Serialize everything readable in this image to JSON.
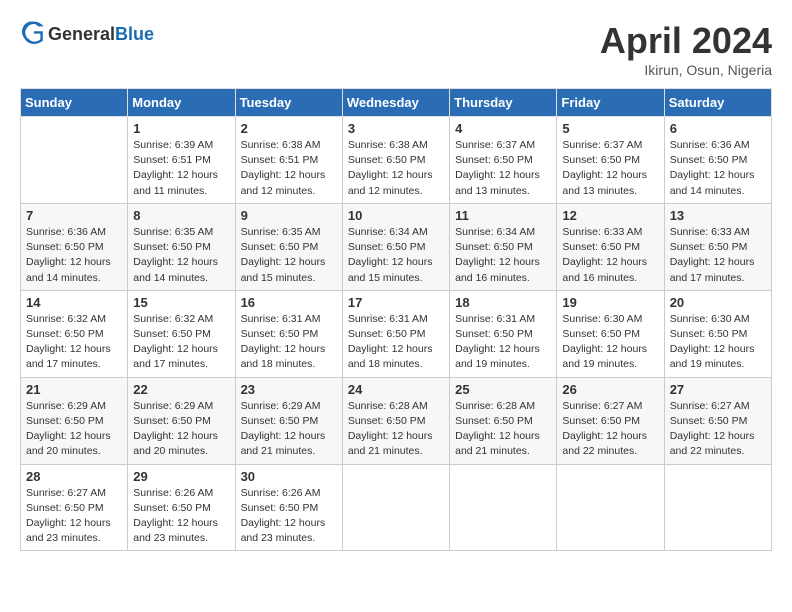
{
  "header": {
    "logo_line1": "General",
    "logo_line2": "Blue",
    "month": "April 2024",
    "location": "Ikirun, Osun, Nigeria"
  },
  "days_of_week": [
    "Sunday",
    "Monday",
    "Tuesday",
    "Wednesday",
    "Thursday",
    "Friday",
    "Saturday"
  ],
  "weeks": [
    [
      {
        "num": "",
        "info": ""
      },
      {
        "num": "1",
        "info": "Sunrise: 6:39 AM\nSunset: 6:51 PM\nDaylight: 12 hours\nand 11 minutes."
      },
      {
        "num": "2",
        "info": "Sunrise: 6:38 AM\nSunset: 6:51 PM\nDaylight: 12 hours\nand 12 minutes."
      },
      {
        "num": "3",
        "info": "Sunrise: 6:38 AM\nSunset: 6:50 PM\nDaylight: 12 hours\nand 12 minutes."
      },
      {
        "num": "4",
        "info": "Sunrise: 6:37 AM\nSunset: 6:50 PM\nDaylight: 12 hours\nand 13 minutes."
      },
      {
        "num": "5",
        "info": "Sunrise: 6:37 AM\nSunset: 6:50 PM\nDaylight: 12 hours\nand 13 minutes."
      },
      {
        "num": "6",
        "info": "Sunrise: 6:36 AM\nSunset: 6:50 PM\nDaylight: 12 hours\nand 14 minutes."
      }
    ],
    [
      {
        "num": "7",
        "info": "Sunrise: 6:36 AM\nSunset: 6:50 PM\nDaylight: 12 hours\nand 14 minutes."
      },
      {
        "num": "8",
        "info": "Sunrise: 6:35 AM\nSunset: 6:50 PM\nDaylight: 12 hours\nand 14 minutes."
      },
      {
        "num": "9",
        "info": "Sunrise: 6:35 AM\nSunset: 6:50 PM\nDaylight: 12 hours\nand 15 minutes."
      },
      {
        "num": "10",
        "info": "Sunrise: 6:34 AM\nSunset: 6:50 PM\nDaylight: 12 hours\nand 15 minutes."
      },
      {
        "num": "11",
        "info": "Sunrise: 6:34 AM\nSunset: 6:50 PM\nDaylight: 12 hours\nand 16 minutes."
      },
      {
        "num": "12",
        "info": "Sunrise: 6:33 AM\nSunset: 6:50 PM\nDaylight: 12 hours\nand 16 minutes."
      },
      {
        "num": "13",
        "info": "Sunrise: 6:33 AM\nSunset: 6:50 PM\nDaylight: 12 hours\nand 17 minutes."
      }
    ],
    [
      {
        "num": "14",
        "info": "Sunrise: 6:32 AM\nSunset: 6:50 PM\nDaylight: 12 hours\nand 17 minutes."
      },
      {
        "num": "15",
        "info": "Sunrise: 6:32 AM\nSunset: 6:50 PM\nDaylight: 12 hours\nand 17 minutes."
      },
      {
        "num": "16",
        "info": "Sunrise: 6:31 AM\nSunset: 6:50 PM\nDaylight: 12 hours\nand 18 minutes."
      },
      {
        "num": "17",
        "info": "Sunrise: 6:31 AM\nSunset: 6:50 PM\nDaylight: 12 hours\nand 18 minutes."
      },
      {
        "num": "18",
        "info": "Sunrise: 6:31 AM\nSunset: 6:50 PM\nDaylight: 12 hours\nand 19 minutes."
      },
      {
        "num": "19",
        "info": "Sunrise: 6:30 AM\nSunset: 6:50 PM\nDaylight: 12 hours\nand 19 minutes."
      },
      {
        "num": "20",
        "info": "Sunrise: 6:30 AM\nSunset: 6:50 PM\nDaylight: 12 hours\nand 19 minutes."
      }
    ],
    [
      {
        "num": "21",
        "info": "Sunrise: 6:29 AM\nSunset: 6:50 PM\nDaylight: 12 hours\nand 20 minutes."
      },
      {
        "num": "22",
        "info": "Sunrise: 6:29 AM\nSunset: 6:50 PM\nDaylight: 12 hours\nand 20 minutes."
      },
      {
        "num": "23",
        "info": "Sunrise: 6:29 AM\nSunset: 6:50 PM\nDaylight: 12 hours\nand 21 minutes."
      },
      {
        "num": "24",
        "info": "Sunrise: 6:28 AM\nSunset: 6:50 PM\nDaylight: 12 hours\nand 21 minutes."
      },
      {
        "num": "25",
        "info": "Sunrise: 6:28 AM\nSunset: 6:50 PM\nDaylight: 12 hours\nand 21 minutes."
      },
      {
        "num": "26",
        "info": "Sunrise: 6:27 AM\nSunset: 6:50 PM\nDaylight: 12 hours\nand 22 minutes."
      },
      {
        "num": "27",
        "info": "Sunrise: 6:27 AM\nSunset: 6:50 PM\nDaylight: 12 hours\nand 22 minutes."
      }
    ],
    [
      {
        "num": "28",
        "info": "Sunrise: 6:27 AM\nSunset: 6:50 PM\nDaylight: 12 hours\nand 23 minutes."
      },
      {
        "num": "29",
        "info": "Sunrise: 6:26 AM\nSunset: 6:50 PM\nDaylight: 12 hours\nand 23 minutes."
      },
      {
        "num": "30",
        "info": "Sunrise: 6:26 AM\nSunset: 6:50 PM\nDaylight: 12 hours\nand 23 minutes."
      },
      {
        "num": "",
        "info": ""
      },
      {
        "num": "",
        "info": ""
      },
      {
        "num": "",
        "info": ""
      },
      {
        "num": "",
        "info": ""
      }
    ]
  ]
}
